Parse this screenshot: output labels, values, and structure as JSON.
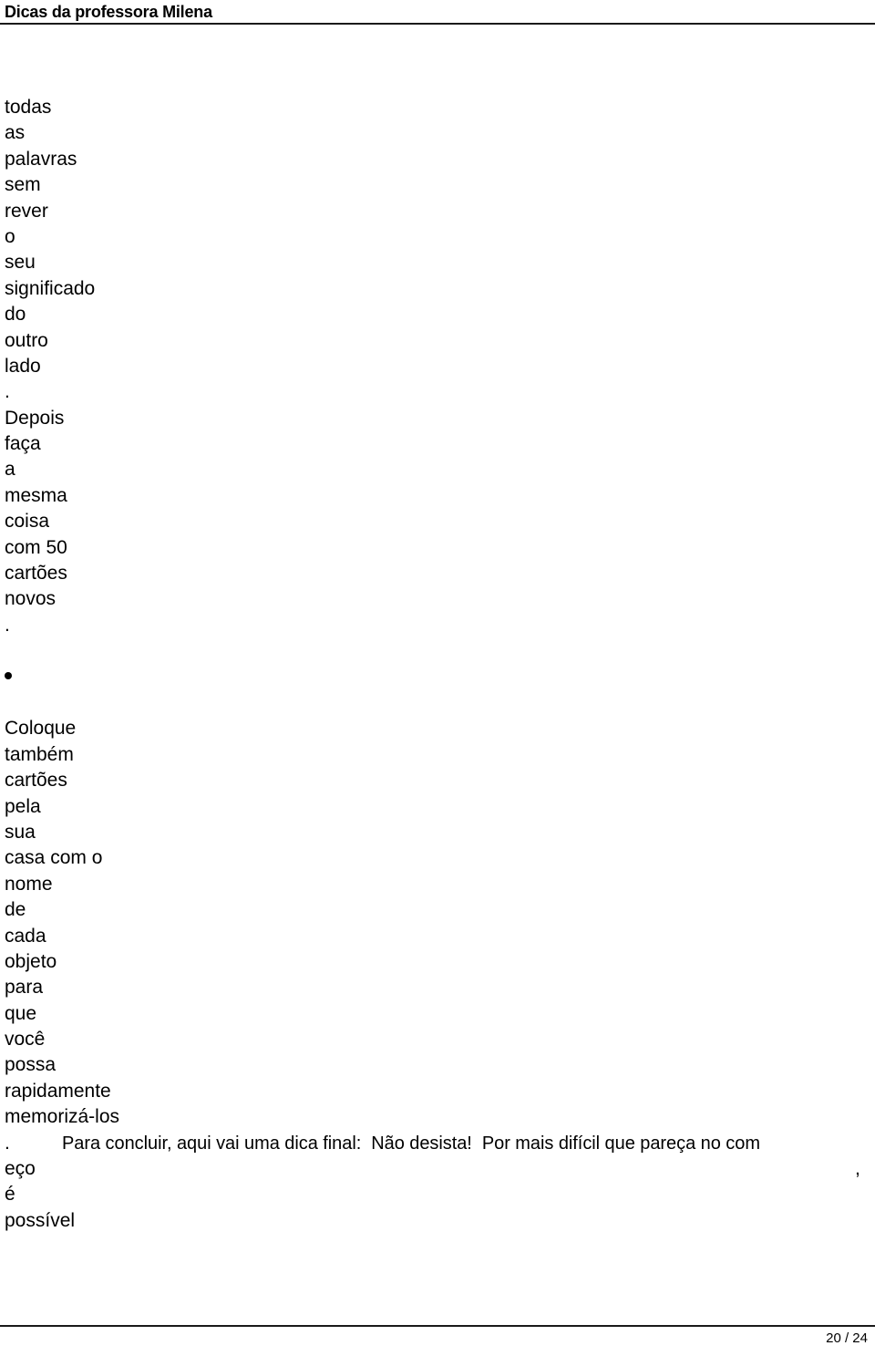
{
  "header": {
    "title": "Dicas da professora Milena"
  },
  "document": {
    "word_lines_top": [
      "todas",
      "as",
      "palavras",
      "sem",
      "rever",
      "o",
      "seu",
      "significado",
      "do",
      "outro",
      "lado",
      ".",
      "Depois",
      "faça",
      "a",
      "mesma",
      "coisa",
      "com 50",
      "cartões",
      "novos",
      "."
    ],
    "bullet": "•",
    "word_lines_bullet": [
      "Coloque",
      "também",
      "cartões",
      "pela",
      "sua",
      "casa com o",
      "nome",
      "de",
      "cada",
      "objeto",
      "para",
      "que",
      "você",
      "possa",
      "rapidamente",
      "memorizá-los"
    ],
    "final_period": ".",
    "paragraph_line": "Para concluir, aqui vai uma dica final:  Não desista!  Por mais difícil que pareça no com",
    "tail_word": "eço",
    "tail_comma": ",",
    "word_lines_tail": [
      "é",
      "possível"
    ]
  },
  "footer": {
    "page_number": "20 / 24"
  }
}
